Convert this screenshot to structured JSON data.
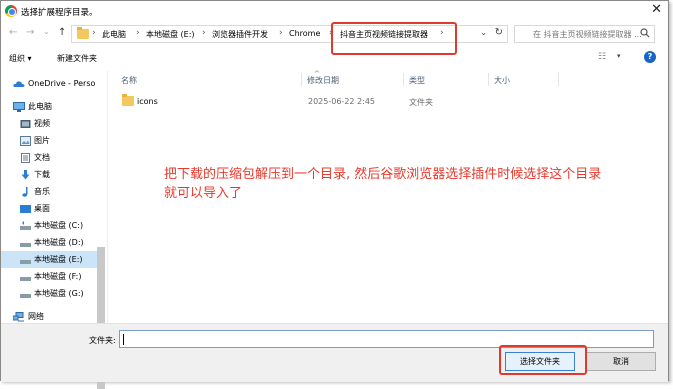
{
  "window": {
    "title": "选择扩展程序目录。",
    "close": "✕"
  },
  "address": {
    "back": "←",
    "forward": "→",
    "recent": "⌄",
    "up": "↑",
    "crumbs": [
      "此电脑",
      "本地磁盘 (E:)",
      "浏览器插件开发",
      "Chrome",
      "抖音主页视频链接提取器"
    ],
    "separator": "›",
    "dropdown": "⌄",
    "refresh": "↻"
  },
  "search": {
    "placeholder": "在 抖音主页视频链接提取器 ..."
  },
  "toolbar": {
    "organize": "组织 ▾",
    "new_folder": "新建文件夹",
    "view": "☷",
    "view_drop": "▾",
    "help": "?"
  },
  "nav": {
    "items": [
      {
        "label": "OneDrive - Perso",
        "icon": "onedrive-icon"
      },
      {
        "label": "此电脑",
        "icon": "computer-icon"
      },
      {
        "label": "视频",
        "icon": "video-icon"
      },
      {
        "label": "图片",
        "icon": "pictures-icon"
      },
      {
        "label": "文档",
        "icon": "documents-icon"
      },
      {
        "label": "下载",
        "icon": "download-icon"
      },
      {
        "label": "音乐",
        "icon": "music-icon"
      },
      {
        "label": "桌面",
        "icon": "desktop-icon"
      },
      {
        "label": "本地磁盘 (C:)",
        "icon": "drive-icon"
      },
      {
        "label": "本地磁盘 (D:)",
        "icon": "drive-icon"
      },
      {
        "label": "本地磁盘 (E:)",
        "icon": "drive-icon"
      },
      {
        "label": "本地磁盘 (F:)",
        "icon": "drive-icon"
      },
      {
        "label": "本地磁盘 (G:)",
        "icon": "drive-icon"
      },
      {
        "label": "网络",
        "icon": "network-icon"
      }
    ]
  },
  "columns": {
    "name": "名称",
    "date": "修改日期",
    "type": "类型",
    "size": "大小",
    "sort": "^"
  },
  "files": [
    {
      "name": "icons",
      "date": "2025-06-22 2:45",
      "type": "文件夹",
      "size": ""
    }
  ],
  "annotation": "把下载的压缩包解压到一个目录, 然后谷歌浏览器选择插件时候选择这个目录就可以导入了",
  "bottom": {
    "filename_label": "文件夹:",
    "filename_value": "",
    "select_button": "选择文件夹",
    "cancel_button": "取消"
  },
  "colors": {
    "highlight": "#e03a2f",
    "annotation": "#e8382c",
    "selected": "#cce4f7"
  }
}
